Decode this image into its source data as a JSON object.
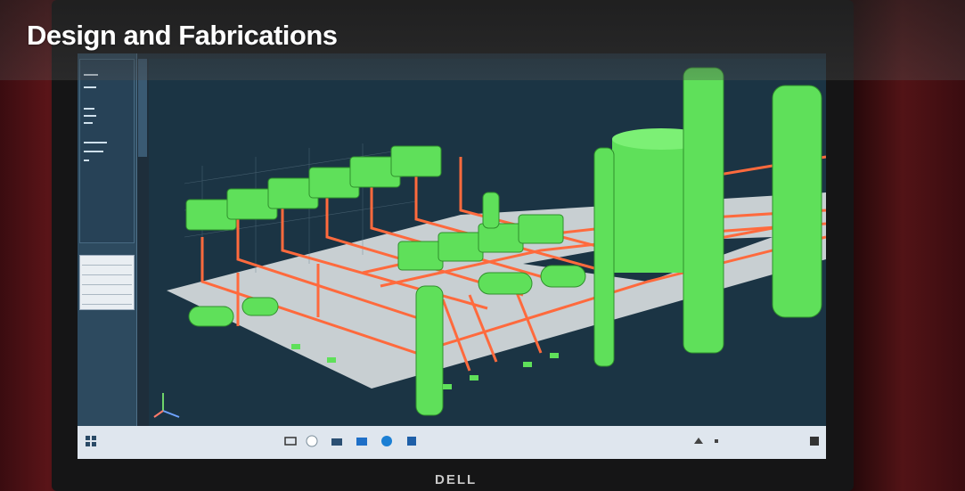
{
  "caption": {
    "title": "Design and Fabrications"
  },
  "brand": {
    "name": "DELL"
  },
  "icons": [
    "windows-start-icon",
    "search-icon",
    "task-view-icon",
    "file-explorer-icon",
    "mail-icon",
    "edge-browser-icon",
    "store-icon",
    "network-icon",
    "volume-icon",
    "notification-icon"
  ],
  "colors": {
    "equipment_green": "#5fe05a",
    "piping_orange": "#ff6a3d",
    "deck_grey": "#c8cfd2",
    "viewport_bg": "#1b3444",
    "caption_text": "#ffffff"
  }
}
